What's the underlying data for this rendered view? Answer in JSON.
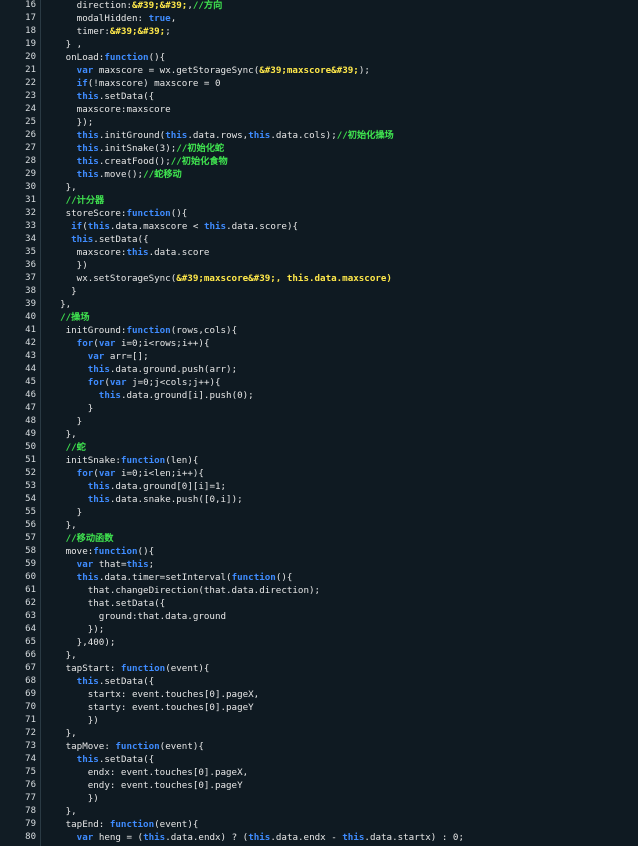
{
  "editor": {
    "language": "javascript",
    "colors": {
      "background": "#0f1a22",
      "keyword": "#3f8cff",
      "comment": "#3fe34f",
      "string": "#ffe84a",
      "text": "#e6e6e6"
    },
    "lines": [
      {
        "n": "16",
        "tokens": [
          [
            "plain",
            "     direction:"
          ],
          [
            "str",
            "&#39;&#39;"
          ],
          [
            "plain",
            ","
          ],
          [
            "cm",
            "//方向"
          ]
        ]
      },
      {
        "n": "17",
        "tokens": [
          [
            "plain",
            "     modalHidden: "
          ],
          [
            "kw",
            "true"
          ],
          [
            "plain",
            ","
          ]
        ]
      },
      {
        "n": "18",
        "tokens": [
          [
            "plain",
            "     timer:"
          ],
          [
            "str",
            "&#39;&#39;"
          ],
          [
            "plain",
            ";"
          ]
        ]
      },
      {
        "n": "19",
        "tokens": [
          [
            "plain",
            "   } ,"
          ]
        ]
      },
      {
        "n": "20",
        "tokens": [
          [
            "plain",
            "   onLoad:"
          ],
          [
            "kw",
            "function"
          ],
          [
            "plain",
            "(){"
          ]
        ]
      },
      {
        "n": "21",
        "tokens": [
          [
            "plain",
            "     "
          ],
          [
            "kw",
            "var"
          ],
          [
            "plain",
            " maxscore = wx.getStorageSync("
          ],
          [
            "str",
            "&#39;maxscore&#39;"
          ],
          [
            "plain",
            ");"
          ]
        ]
      },
      {
        "n": "22",
        "tokens": [
          [
            "plain",
            "     "
          ],
          [
            "kw",
            "if"
          ],
          [
            "plain",
            "(!maxscore) maxscore = 0"
          ]
        ]
      },
      {
        "n": "23",
        "tokens": [
          [
            "plain",
            "     "
          ],
          [
            "kw",
            "this"
          ],
          [
            "plain",
            ".setData({"
          ]
        ]
      },
      {
        "n": "24",
        "tokens": [
          [
            "plain",
            "     maxscore:maxscore"
          ]
        ]
      },
      {
        "n": "25",
        "tokens": [
          [
            "plain",
            "     });"
          ]
        ]
      },
      {
        "n": "26",
        "tokens": [
          [
            "plain",
            "     "
          ],
          [
            "kw",
            "this"
          ],
          [
            "plain",
            ".initGround("
          ],
          [
            "kw",
            "this"
          ],
          [
            "plain",
            ".data.rows,"
          ],
          [
            "kw",
            "this"
          ],
          [
            "plain",
            ".data.cols);"
          ],
          [
            "cm",
            "//初始化操场"
          ]
        ]
      },
      {
        "n": "27",
        "tokens": [
          [
            "plain",
            "     "
          ],
          [
            "kw",
            "this"
          ],
          [
            "plain",
            ".initSnake(3);"
          ],
          [
            "cm",
            "//初始化蛇"
          ]
        ]
      },
      {
        "n": "28",
        "tokens": [
          [
            "plain",
            "     "
          ],
          [
            "kw",
            "this"
          ],
          [
            "plain",
            ".creatFood();"
          ],
          [
            "cm",
            "//初始化食物"
          ]
        ]
      },
      {
        "n": "29",
        "tokens": [
          [
            "plain",
            "     "
          ],
          [
            "kw",
            "this"
          ],
          [
            "plain",
            ".move();"
          ],
          [
            "cm",
            "//蛇移动"
          ]
        ]
      },
      {
        "n": "30",
        "tokens": [
          [
            "plain",
            "   },"
          ]
        ]
      },
      {
        "n": "31",
        "tokens": [
          [
            "plain",
            "   "
          ],
          [
            "cm",
            "//计分器"
          ]
        ]
      },
      {
        "n": "32",
        "tokens": [
          [
            "plain",
            "   storeScore:"
          ],
          [
            "kw",
            "function"
          ],
          [
            "plain",
            "(){"
          ]
        ]
      },
      {
        "n": "33",
        "tokens": [
          [
            "plain",
            "    "
          ],
          [
            "kw",
            "if"
          ],
          [
            "plain",
            "("
          ],
          [
            "kw",
            "this"
          ],
          [
            "plain",
            ".data.maxscore < "
          ],
          [
            "kw",
            "this"
          ],
          [
            "plain",
            ".data.score){"
          ]
        ]
      },
      {
        "n": "34",
        "tokens": [
          [
            "plain",
            "    "
          ],
          [
            "kw",
            "this"
          ],
          [
            "plain",
            ".setData({"
          ]
        ]
      },
      {
        "n": "35",
        "tokens": [
          [
            "plain",
            "     maxscore:"
          ],
          [
            "kw",
            "this"
          ],
          [
            "plain",
            ".data.score"
          ]
        ]
      },
      {
        "n": "36",
        "tokens": [
          [
            "plain",
            "     })"
          ]
        ]
      },
      {
        "n": "37",
        "tokens": [
          [
            "plain",
            "     wx.setStorageSync("
          ],
          [
            "str",
            "&#39;maxscore&#39;, this.data.maxscore)"
          ]
        ]
      },
      {
        "n": "38",
        "tokens": [
          [
            "plain",
            "    }"
          ]
        ]
      },
      {
        "n": "39",
        "tokens": [
          [
            "plain",
            "  },"
          ]
        ]
      },
      {
        "n": "40",
        "tokens": [
          [
            "plain",
            "  "
          ],
          [
            "cm",
            "//操场"
          ]
        ]
      },
      {
        "n": "41",
        "tokens": [
          [
            "plain",
            "   initGround:"
          ],
          [
            "kw",
            "function"
          ],
          [
            "plain",
            "(rows,cols){"
          ]
        ]
      },
      {
        "n": "42",
        "tokens": [
          [
            "plain",
            "     "
          ],
          [
            "kw",
            "for"
          ],
          [
            "plain",
            "("
          ],
          [
            "kw",
            "var"
          ],
          [
            "plain",
            " i=0;i<rows;i++){"
          ]
        ]
      },
      {
        "n": "43",
        "tokens": [
          [
            "plain",
            "       "
          ],
          [
            "kw",
            "var"
          ],
          [
            "plain",
            " arr=[];"
          ]
        ]
      },
      {
        "n": "44",
        "tokens": [
          [
            "plain",
            "       "
          ],
          [
            "kw",
            "this"
          ],
          [
            "plain",
            ".data.ground.push(arr);"
          ]
        ]
      },
      {
        "n": "45",
        "tokens": [
          [
            "plain",
            "       "
          ],
          [
            "kw",
            "for"
          ],
          [
            "plain",
            "("
          ],
          [
            "kw",
            "var"
          ],
          [
            "plain",
            " j=0;j<cols;j++){"
          ]
        ]
      },
      {
        "n": "46",
        "tokens": [
          [
            "plain",
            "         "
          ],
          [
            "kw",
            "this"
          ],
          [
            "plain",
            ".data.ground[i].push(0);"
          ]
        ]
      },
      {
        "n": "47",
        "tokens": [
          [
            "plain",
            "       }"
          ]
        ]
      },
      {
        "n": "48",
        "tokens": [
          [
            "plain",
            "     }"
          ]
        ]
      },
      {
        "n": "49",
        "tokens": [
          [
            "plain",
            "   },"
          ]
        ]
      },
      {
        "n": "50",
        "tokens": [
          [
            "plain",
            "   "
          ],
          [
            "cm",
            "//蛇"
          ]
        ]
      },
      {
        "n": "51",
        "tokens": [
          [
            "plain",
            "   initSnake:"
          ],
          [
            "kw",
            "function"
          ],
          [
            "plain",
            "(len){"
          ]
        ]
      },
      {
        "n": "52",
        "tokens": [
          [
            "plain",
            "     "
          ],
          [
            "kw",
            "for"
          ],
          [
            "plain",
            "("
          ],
          [
            "kw",
            "var"
          ],
          [
            "plain",
            " i=0;i<len;i++){"
          ]
        ]
      },
      {
        "n": "53",
        "tokens": [
          [
            "plain",
            "       "
          ],
          [
            "kw",
            "this"
          ],
          [
            "plain",
            ".data.ground[0][i]=1;"
          ]
        ]
      },
      {
        "n": "54",
        "tokens": [
          [
            "plain",
            "       "
          ],
          [
            "kw",
            "this"
          ],
          [
            "plain",
            ".data.snake.push([0,i]);"
          ]
        ]
      },
      {
        "n": "55",
        "tokens": [
          [
            "plain",
            "     }"
          ]
        ]
      },
      {
        "n": "56",
        "tokens": [
          [
            "plain",
            "   },"
          ]
        ]
      },
      {
        "n": "57",
        "tokens": [
          [
            "plain",
            "   "
          ],
          [
            "cm",
            "//移动函数"
          ]
        ]
      },
      {
        "n": "58",
        "tokens": [
          [
            "plain",
            "   move:"
          ],
          [
            "kw",
            "function"
          ],
          [
            "plain",
            "(){"
          ]
        ]
      },
      {
        "n": "59",
        "tokens": [
          [
            "plain",
            "     "
          ],
          [
            "kw",
            "var"
          ],
          [
            "plain",
            " that="
          ],
          [
            "kw",
            "this"
          ],
          [
            "plain",
            ";"
          ]
        ]
      },
      {
        "n": "60",
        "tokens": [
          [
            "plain",
            "     "
          ],
          [
            "kw",
            "this"
          ],
          [
            "plain",
            ".data.timer=setInterval("
          ],
          [
            "kw",
            "function"
          ],
          [
            "plain",
            "(){"
          ]
        ]
      },
      {
        "n": "61",
        "tokens": [
          [
            "plain",
            "       that.changeDirection(that.data.direction);"
          ]
        ]
      },
      {
        "n": "62",
        "tokens": [
          [
            "plain",
            "       that.setData({"
          ]
        ]
      },
      {
        "n": "63",
        "tokens": [
          [
            "plain",
            "         ground:that.data.ground"
          ]
        ]
      },
      {
        "n": "64",
        "tokens": [
          [
            "plain",
            "       });"
          ]
        ]
      },
      {
        "n": "65",
        "tokens": [
          [
            "plain",
            "     },400);"
          ]
        ]
      },
      {
        "n": "66",
        "tokens": [
          [
            "plain",
            "   },"
          ]
        ]
      },
      {
        "n": "67",
        "tokens": [
          [
            "plain",
            "   tapStart: "
          ],
          [
            "kw",
            "function"
          ],
          [
            "plain",
            "(event){"
          ]
        ]
      },
      {
        "n": "68",
        "tokens": [
          [
            "plain",
            "     "
          ],
          [
            "kw",
            "this"
          ],
          [
            "plain",
            ".setData({"
          ]
        ]
      },
      {
        "n": "69",
        "tokens": [
          [
            "plain",
            "       startx: event.touches[0].pageX,"
          ]
        ]
      },
      {
        "n": "70",
        "tokens": [
          [
            "plain",
            "       starty: event.touches[0].pageY"
          ]
        ]
      },
      {
        "n": "71",
        "tokens": [
          [
            "plain",
            "       })"
          ]
        ]
      },
      {
        "n": "72",
        "tokens": [
          [
            "plain",
            "   },"
          ]
        ]
      },
      {
        "n": "73",
        "tokens": [
          [
            "plain",
            "   tapMove: "
          ],
          [
            "kw",
            "function"
          ],
          [
            "plain",
            "(event){"
          ]
        ]
      },
      {
        "n": "74",
        "tokens": [
          [
            "plain",
            "     "
          ],
          [
            "kw",
            "this"
          ],
          [
            "plain",
            ".setData({"
          ]
        ]
      },
      {
        "n": "75",
        "tokens": [
          [
            "plain",
            "       endx: event.touches[0].pageX,"
          ]
        ]
      },
      {
        "n": "76",
        "tokens": [
          [
            "plain",
            "       endy: event.touches[0].pageY"
          ]
        ]
      },
      {
        "n": "77",
        "tokens": [
          [
            "plain",
            "       })"
          ]
        ]
      },
      {
        "n": "78",
        "tokens": [
          [
            "plain",
            "   },"
          ]
        ]
      },
      {
        "n": "79",
        "tokens": [
          [
            "plain",
            "   tapEnd: "
          ],
          [
            "kw",
            "function"
          ],
          [
            "plain",
            "(event){"
          ]
        ]
      },
      {
        "n": "80",
        "tokens": [
          [
            "plain",
            "     "
          ],
          [
            "kw",
            "var"
          ],
          [
            "plain",
            " heng = ("
          ],
          [
            "kw",
            "this"
          ],
          [
            "plain",
            ".data.endx) ? ("
          ],
          [
            "kw",
            "this"
          ],
          [
            "plain",
            ".data.endx - "
          ],
          [
            "kw",
            "this"
          ],
          [
            "plain",
            ".data.startx) : 0;"
          ]
        ]
      }
    ]
  }
}
